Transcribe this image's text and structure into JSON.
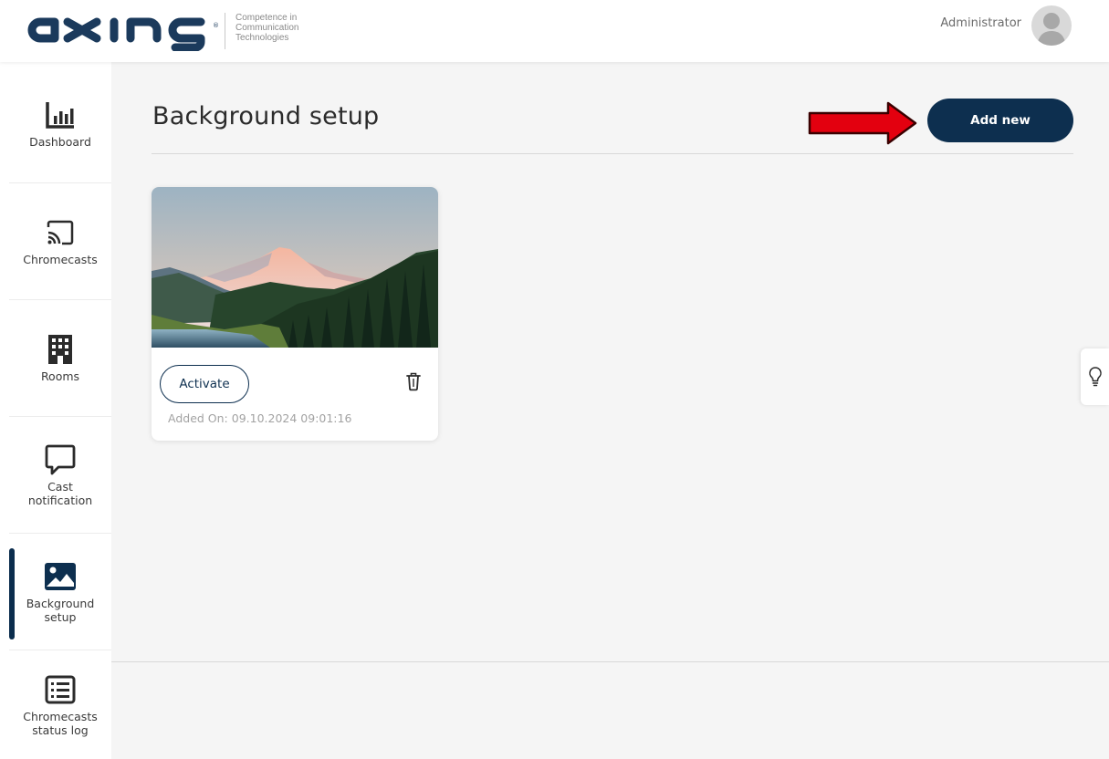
{
  "header": {
    "logo_text": "axing",
    "logo_reg": "®",
    "tagline": [
      "Competence in",
      "Communication",
      "Technologies"
    ],
    "user_name": "Administrator"
  },
  "sidebar": {
    "items": [
      {
        "label": "Dashboard",
        "icon": "bar-chart-icon"
      },
      {
        "label": "Chromecasts",
        "icon": "cast-icon"
      },
      {
        "label": "Rooms",
        "icon": "building-icon"
      },
      {
        "label": "Cast\nnotification",
        "icon": "chat-bubble-icon"
      },
      {
        "label": "Background\nsetup",
        "icon": "image-icon",
        "active": true
      },
      {
        "label": "Chromecasts\nstatus log",
        "icon": "list-icon"
      }
    ]
  },
  "main": {
    "title": "Background setup",
    "add_button": "Add new",
    "backgrounds": [
      {
        "activate_label": "Activate",
        "added_on": "Added On: 09.10.2024 09:01:16",
        "image": "mountain-lake-landscape"
      }
    ]
  },
  "colors": {
    "primary": "#0d2f4f",
    "annotation_arrow": "#e3000f",
    "background": "#f5f5f5"
  }
}
